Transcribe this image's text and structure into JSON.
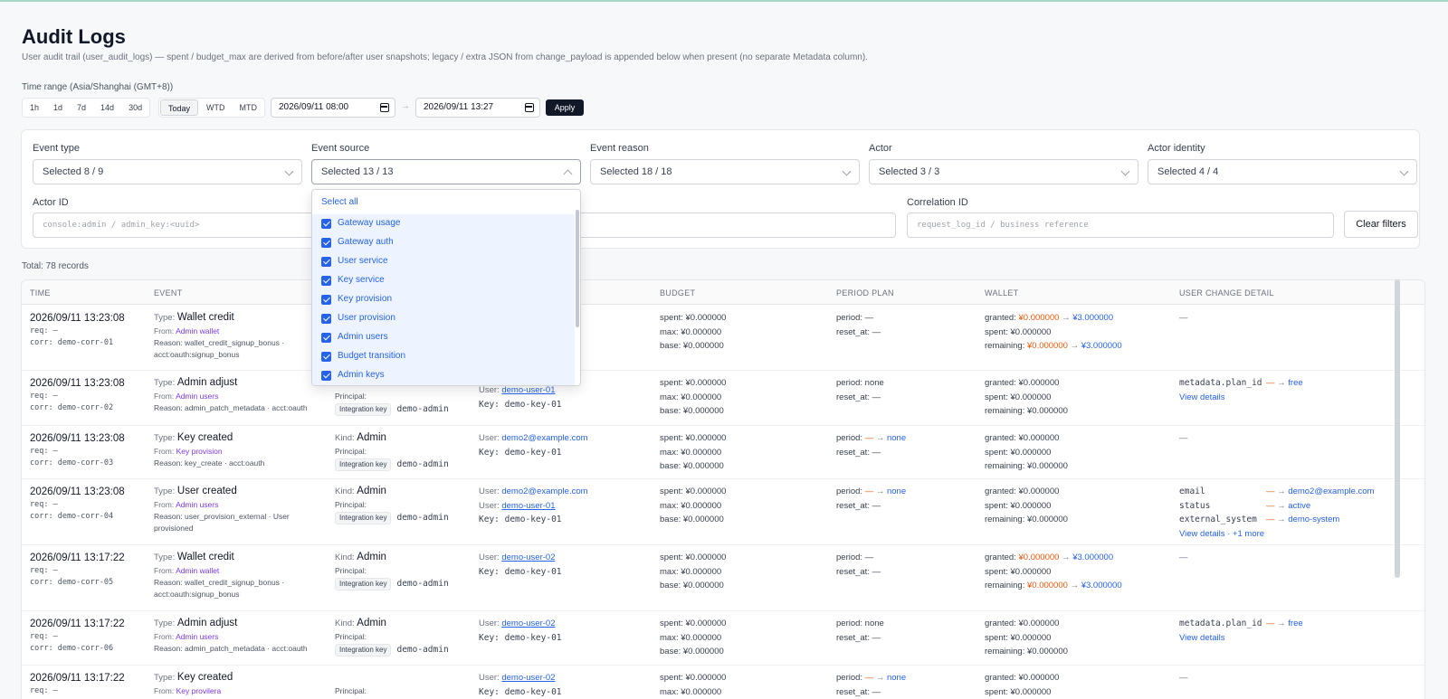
{
  "page": {
    "title": "Audit Logs",
    "subtitle": "User audit trail (user_audit_logs) — spent / budget_max are derived from before/after user snapshots; legacy / extra JSON from change_payload is appended below when present (no separate Metadata column)."
  },
  "time_range": {
    "label": "Time range (Asia/Shanghai (GMT+8))",
    "quick": [
      "1h",
      "1d",
      "7d",
      "14d",
      "30d"
    ],
    "relative": [
      "Today",
      "WTD",
      "MTD"
    ],
    "active": "Today",
    "from": "2026/09/11 08:00",
    "to": "2026/09/11 13:27",
    "arrow": "→",
    "apply_label": "Apply"
  },
  "filters": {
    "event_type": {
      "label": "Event type",
      "value": "Selected 8 / 9"
    },
    "event_source": {
      "label": "Event source",
      "value": "Selected 13 / 13"
    },
    "event_reason": {
      "label": "Event reason",
      "value": "Selected 18 / 18"
    },
    "actor": {
      "label": "Actor",
      "value": "Selected 3 / 3"
    },
    "actor_identity": {
      "label": "Actor identity",
      "value": "Selected 4 / 4"
    },
    "actor_id": {
      "label": "Actor ID",
      "placeholder": "console:admin / admin_key:<uuid>"
    },
    "correlation_id": {
      "label": "Correlation ID",
      "placeholder": "request_log_id / business reference"
    },
    "clear_label": "Clear filters"
  },
  "dropdown": {
    "select_all": "Select all",
    "options": [
      "Gateway usage",
      "Gateway auth",
      "User service",
      "Key service",
      "Key provision",
      "User provision",
      "Admin users",
      "Budget transition",
      "Admin keys"
    ]
  },
  "total": "Total: 78 records",
  "table": {
    "headers": {
      "time": "TIME",
      "event": "EVENT",
      "budget": "BUDGET",
      "period": "PERIOD PLAN",
      "wallet": "WALLET",
      "detail": "USER CHANGE DETAIL"
    },
    "rows": [
      {
        "time": "2026/09/11 13:23:08",
        "req": "req: –",
        "corr": "corr: demo-corr-01",
        "type": "Wallet credit",
        "from": "Admin wallet",
        "reason": "Reason: wallet_credit_signup_bonus ·",
        "reason2": "acct:oauth:signup_bonus",
        "spent": "spent: ¥0.000000",
        "max": "max: ¥0.000000",
        "base": "base: ¥0.000000",
        "period": "period: —",
        "reset": "reset_at: —",
        "granted_a": "¥0.000000",
        "granted_b": "¥3.000000",
        "wspent": "spent: ¥0.000000",
        "rem_a": "¥0.000000",
        "rem_b": "¥3.000000",
        "detail": "—"
      },
      {
        "time": "2026/09/11 13:23:08",
        "req": "req: –",
        "corr": "corr: demo-corr-02",
        "type": "Admin adjust",
        "from": "Admin users",
        "reason": "Reason: admin_patch_metadata · acct:oauth",
        "principal": "Principal:",
        "pill": "Integration key",
        "pname": "demo-admin",
        "user": "demo-user-01",
        "key": "Key: demo-key-01",
        "spent": "spent: ¥0.000000",
        "max": "max: ¥0.000000",
        "base": "base: ¥0.000000",
        "period": "period: none",
        "reset": "reset_at: —",
        "granted": "granted: ¥0.000000",
        "wspent": "spent: ¥0.000000",
        "remaining": "remaining: ¥0.000000",
        "dkey": "metadata.plan_id",
        "dval": "free",
        "dlink": "View details"
      },
      {
        "time": "2026/09/11 13:23:08",
        "req": "req: –",
        "corr": "corr: demo-corr-03",
        "type": "Key created",
        "from": "Key provision",
        "reason": "Reason: key_create · acct:oauth",
        "kind": "Admin",
        "principal": "Principal:",
        "pill": "Integration key",
        "pname": "demo-admin",
        "user": "demo2@example.com",
        "key": "Key: demo-key-01",
        "spent": "spent: ¥0.000000",
        "max": "max: ¥0.000000",
        "base": "base: ¥0.000000",
        "period_val": "none",
        "reset": "reset_at: —",
        "granted": "granted: ¥0.000000",
        "wspent": "spent: ¥0.000000",
        "remaining": "remaining: ¥0.000000",
        "detail": "—"
      },
      {
        "time": "2026/09/11 13:23:08",
        "req": "req: –",
        "corr": "corr: demo-corr-04",
        "type": "User created",
        "from": "Admin users",
        "reason": "Reason: user_provision_external · User",
        "reason2": "provisioned",
        "kind": "Admin",
        "principal": "Principal:",
        "pill": "Integration key",
        "pname": "demo-admin",
        "user": "demo2@example.com",
        "user2": "demo-user-01",
        "key": "Key: demo-key-01",
        "spent": "spent: ¥0.000000",
        "max": "max: ¥0.000000",
        "base": "base: ¥0.000000",
        "period_val": "none",
        "reset": "reset_at: —",
        "granted": "granted: ¥0.000000",
        "wspent": "spent: ¥0.000000",
        "remaining": "remaining: ¥0.000000",
        "d1k": "email",
        "d1v": "demo2@example.com",
        "d2k": "status",
        "d2v": "active",
        "d3k": "external_system",
        "d3v": "demo-system",
        "dlink": "View details · +1 more"
      },
      {
        "time": "2026/09/11 13:17:22",
        "req": "req: –",
        "corr": "corr: demo-corr-05",
        "type": "Wallet credit",
        "from": "Admin wallet",
        "reason": "Reason: wallet_credit_signup_bonus ·",
        "reason2": "acct:oauth:signup_bonus",
        "kind": "Admin",
        "principal": "Principal:",
        "pill": "Integration key",
        "pname": "demo-admin",
        "user": "demo-user-02",
        "key": "Key: demo-key-01",
        "spent": "spent: ¥0.000000",
        "max": "max: ¥0.000000",
        "base": "base: ¥0.000000",
        "period": "period: —",
        "reset": "reset_at: —",
        "granted_a": "¥0.000000",
        "granted_b": "¥3.000000",
        "wspent": "spent: ¥0.000000",
        "rem_a": "¥0.000000",
        "rem_b": "¥3.000000",
        "detail": "—"
      },
      {
        "time": "2026/09/11 13:17:22",
        "req": "req: –",
        "corr": "corr: demo-corr-06",
        "type": "Admin adjust",
        "from": "Admin users",
        "reason": "Reason: admin_patch_metadata · acct:oauth",
        "kind": "Admin",
        "principal": "Principal:",
        "pill": "Integration key",
        "pname": "demo-admin",
        "user": "demo-user-02",
        "key": "Key: demo-key-01",
        "spent": "spent: ¥0.000000",
        "max": "max: ¥0.000000",
        "base": "base: ¥0.000000",
        "period": "period: none",
        "reset": "reset_at: —",
        "granted": "granted: ¥0.000000",
        "wspent": "spent: ¥0.000000",
        "remaining": "remaining: ¥0.000000",
        "dkey": "metadata.plan_id",
        "dval": "free",
        "dlink": "View details"
      },
      {
        "time": "2026/09/11 13:17:22",
        "req": "req: –",
        "type": "Key created",
        "from": "Key provilera",
        "principal": "Principal:",
        "user": "demo-user-02",
        "key": "Key: demo-key-01",
        "spent": "spent: ¥0.000000",
        "max": "max: ¥0.000000",
        "period_val": "none",
        "reset": "reset_at: —",
        "granted": "granted: ¥0.000000",
        "wspent": "spent: ¥0.000000",
        "detail": "—"
      }
    ],
    "labels": {
      "type": "Type:",
      "from": "From:",
      "kind": "Kind:",
      "user": "User:",
      "granted": "granted:",
      "remaining": "remaining:",
      "period": "period:",
      "arrow": "→",
      "dash": "—"
    }
  }
}
